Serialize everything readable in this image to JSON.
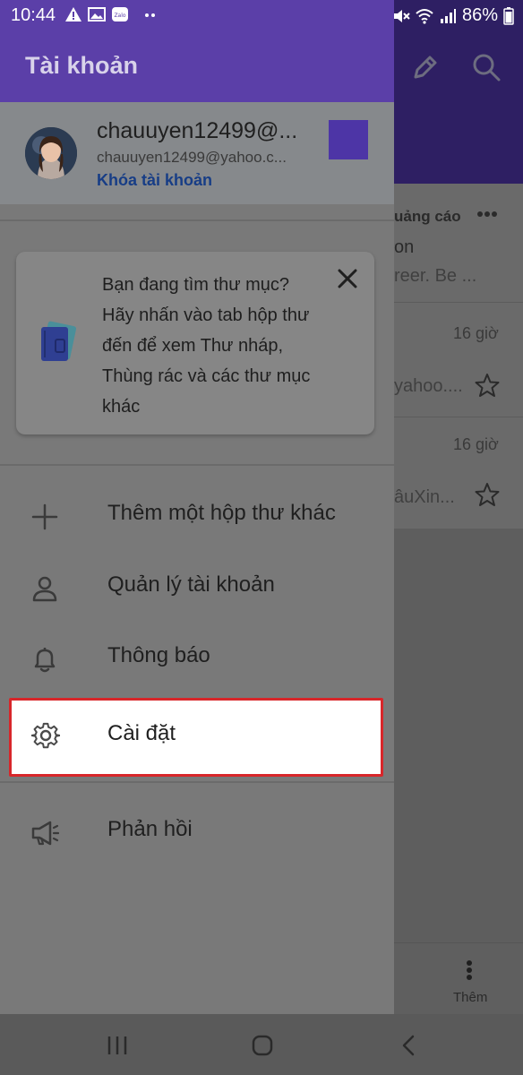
{
  "status_bar": {
    "time": "10:44",
    "battery": "86%",
    "left_icons": [
      "warning-icon",
      "image-icon",
      "zalo-icon",
      "more-dots-icon"
    ],
    "right_icons": [
      "mute-icon",
      "wifi-icon",
      "signal-icon",
      "battery-icon"
    ]
  },
  "drawer": {
    "title": "Tài khoản",
    "account": {
      "name": "chauuyen12499@...",
      "email": "chauuyen12499@yahoo.c...",
      "lock_label": "Khóa tài khoản",
      "swatch_color": "#4d35a6"
    },
    "tip": {
      "text": "Bạn đang tìm thư mục? Hãy nhấn vào tab hộp thư đến để xem Thư nháp, Thùng rác và các thư mục khác"
    },
    "menu": {
      "add_mailbox": "Thêm một hộp thư khác",
      "manage_accounts": "Quản lý tài khoản",
      "notifications": "Thông báo",
      "settings": "Cài đặt",
      "feedback": "Phản hồi"
    }
  },
  "background": {
    "ad_label": "uảng cáo",
    "row1_title": "on",
    "row1_snippet": "reer. Be ...",
    "row2_time": "16 giờ",
    "row2_snippet": "yahoo....",
    "row3_time": "16 giờ",
    "row3_snippet": "âuXin...",
    "bottom_more_label": "Thêm"
  },
  "colors": {
    "drawer_header": "#5b3fa8",
    "highlight_border": "#d8262a",
    "link": "#173d86"
  }
}
